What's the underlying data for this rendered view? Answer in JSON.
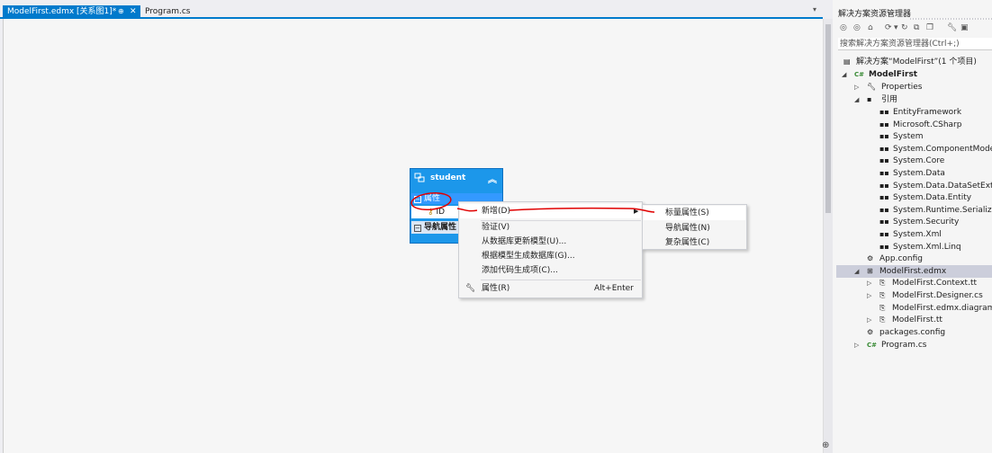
{
  "tabs": {
    "active_label": "ModelFirst.edmx [关系图1]*",
    "pin_glyph": "⊕",
    "close_glyph": "✕",
    "second_label": "Program.cs"
  },
  "entity": {
    "name": "student",
    "properties_header": "属性",
    "property_id": "ID",
    "nav_header": "导航属性"
  },
  "context_menu": {
    "items": [
      {
        "label": "新增(D)",
        "shortcut": "",
        "has_submenu": true
      },
      {
        "label": "验证(V)",
        "shortcut": "",
        "has_submenu": false
      },
      {
        "label": "从数据库更新模型(U)...",
        "shortcut": "",
        "has_submenu": false
      },
      {
        "label": "根据模型生成数据库(G)...",
        "shortcut": "",
        "has_submenu": false
      },
      {
        "label": "添加代码生成项(C)...",
        "shortcut": "",
        "has_submenu": false
      },
      {
        "label": "属性(R)",
        "shortcut": "Alt+Enter",
        "has_submenu": false,
        "icon": "wrench-icon"
      }
    ]
  },
  "submenu": {
    "items": [
      {
        "label": "标量属性(S)"
      },
      {
        "label": "导航属性(N)"
      },
      {
        "label": "复杂属性(C)"
      }
    ]
  },
  "solution_explorer": {
    "title": "解决方案资源管理器",
    "search_placeholder": "搜索解决方案资源管理器(Ctrl+;)",
    "tree": [
      {
        "label": "解决方案“ModelFirst”(1 个项目)",
        "icon": "solution-icon"
      },
      {
        "label": "ModelFirst",
        "icon": "csharp-project-icon",
        "bold": true
      },
      {
        "label": "Properties",
        "icon": "wrench-icon"
      },
      {
        "label": "引用",
        "icon": "references-icon"
      },
      {
        "label": "EntityFramework",
        "icon": "reference-icon"
      },
      {
        "label": "Microsoft.CSharp",
        "icon": "reference-icon"
      },
      {
        "label": "System",
        "icon": "reference-icon"
      },
      {
        "label": "System.ComponentModel.",
        "icon": "reference-icon"
      },
      {
        "label": "System.Core",
        "icon": "reference-icon"
      },
      {
        "label": "System.Data",
        "icon": "reference-icon"
      },
      {
        "label": "System.Data.DataSetExtens",
        "icon": "reference-icon"
      },
      {
        "label": "System.Data.Entity",
        "icon": "reference-icon"
      },
      {
        "label": "System.Runtime.Serializatio",
        "icon": "reference-icon"
      },
      {
        "label": "System.Security",
        "icon": "reference-icon"
      },
      {
        "label": "System.Xml",
        "icon": "reference-icon"
      },
      {
        "label": "System.Xml.Linq",
        "icon": "reference-icon"
      },
      {
        "label": "App.config",
        "icon": "config-file-icon"
      },
      {
        "label": "ModelFirst.edmx",
        "icon": "edmx-file-icon",
        "selected": true
      },
      {
        "label": "ModelFirst.Context.tt",
        "icon": "tt-file-icon"
      },
      {
        "label": "ModelFirst.Designer.cs",
        "icon": "tt-file-icon"
      },
      {
        "label": "ModelFirst.edmx.diagram",
        "icon": "file-icon"
      },
      {
        "label": "ModelFirst.tt",
        "icon": "tt-file-icon"
      },
      {
        "label": "packages.config",
        "icon": "config-file-icon"
      },
      {
        "label": "Program.cs",
        "icon": "csharp-file-icon"
      }
    ]
  },
  "colors": {
    "accent": "#007acc",
    "entity_blue": "#1c97ea",
    "annotation_red": "#e00000"
  }
}
